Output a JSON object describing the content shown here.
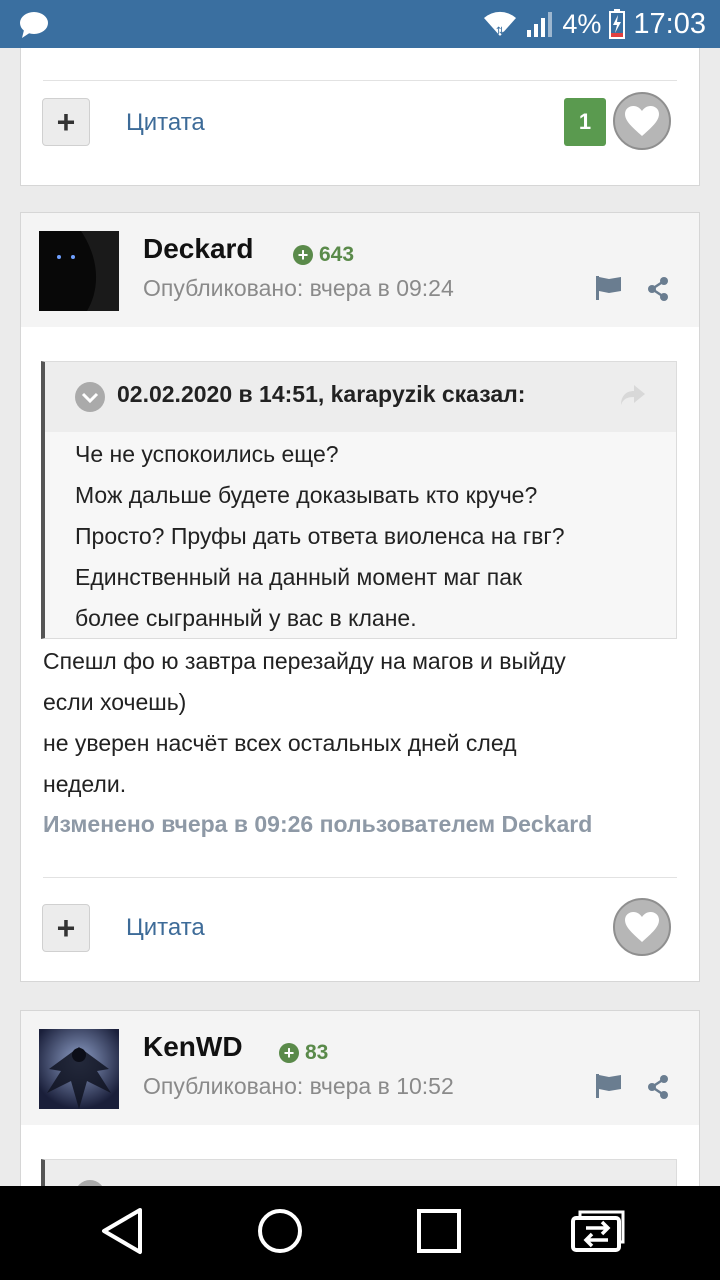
{
  "status_bar": {
    "battery": "4%",
    "time": "17:03"
  },
  "posts": [
    {
      "quote_label": "Цитата",
      "like_count": "1"
    },
    {
      "author": "Deckard",
      "reputation": "643",
      "published": "Опубликовано: вчера в 09:24",
      "quote": {
        "citation": "02.02.2020 в 14:51, karapyzik сказал:",
        "lines": [
          "Че не успокоились еще?",
          "Мож дальше будете доказывать кто круче?",
          "Просто? Пруфы дать ответа виоленса на гвг?",
          "Единственный на данный момент маг пак",
          "более сыгранный у вас в клане."
        ]
      },
      "body_lines": [
        "Спешл фо ю завтра перезайду на магов и выйду",
        "если хочешь)",
        "не уверен насчёт всех остальных дней след",
        "недели."
      ],
      "edited": "Изменено вчера в 09:26 пользователем Deckard",
      "quote_label": "Цитата"
    },
    {
      "author": "KenWD",
      "reputation": "83",
      "published": "Опубликовано: вчера в 10:52"
    }
  ]
}
